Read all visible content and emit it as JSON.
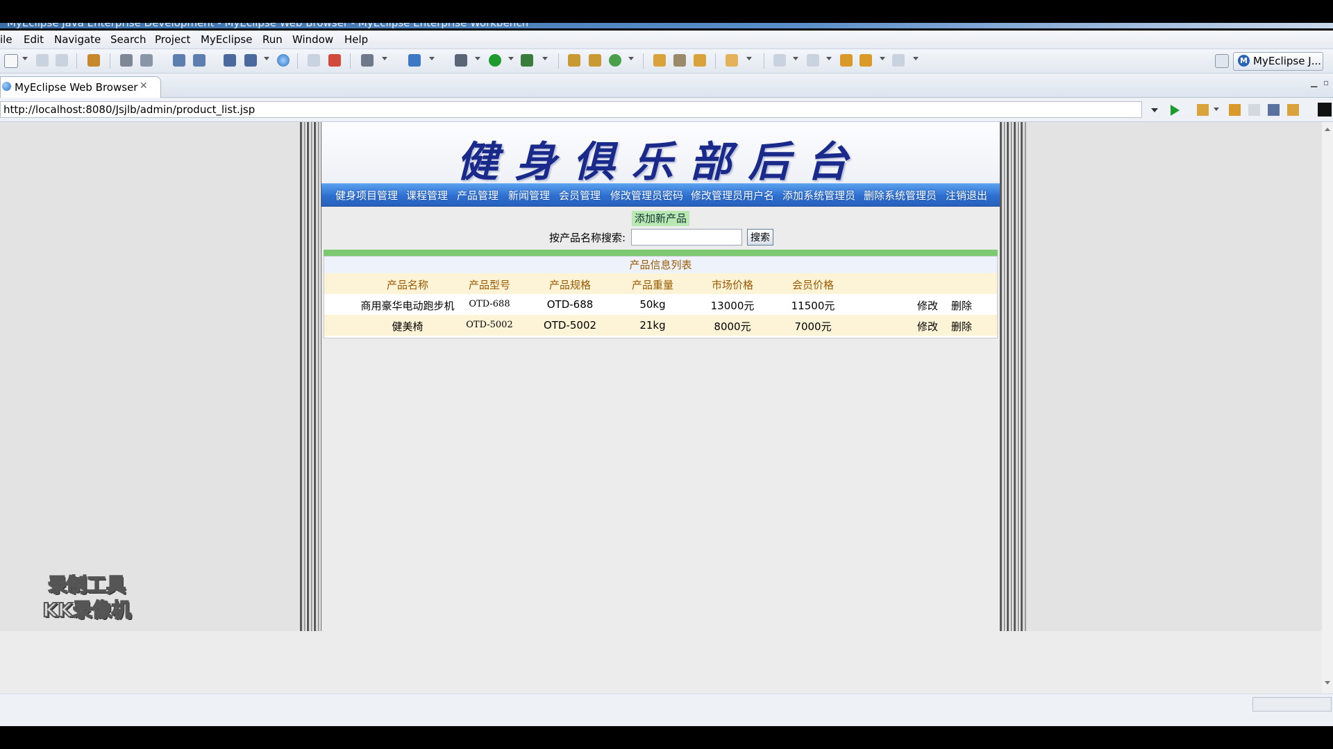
{
  "window": {
    "title": "MyEclipse Java Enterprise Development - MyEclipse Web Browser - MyEclipse Enterprise Workbench"
  },
  "menu": {
    "items": [
      "ile",
      "Edit",
      "Navigate",
      "Search",
      "Project",
      "MyEclipse",
      "Run",
      "Window",
      "Help"
    ]
  },
  "toolbar": {
    "perspective_label": "MyEclipse J..."
  },
  "editor_tab": {
    "label": "MyEclipse Web Browser",
    "close": "✕"
  },
  "address_bar": {
    "url": "http://localhost:8080/Jsjlb/admin/product_list.jsp"
  },
  "page": {
    "banner_title": "健身俱乐部后台",
    "nav": [
      "健身项目管理",
      "课程管理",
      "产品管理",
      "新闻管理",
      "会员管理",
      "修改管理员密码",
      "修改管理员用户名",
      "添加系统管理员",
      "删除系统管理员",
      "注销退出"
    ],
    "add_link": "添加新产品",
    "search": {
      "label": "按产品名称搜索:",
      "value": "",
      "button": "搜索"
    },
    "table": {
      "caption": "产品信息列表",
      "headers": [
        "产品名称",
        "产品型号",
        "产品规格",
        "产品重量",
        "市场价格",
        "会员价格"
      ],
      "rows": [
        {
          "name": "商用豪华电动跑步机",
          "model": "OTD-688",
          "spec": "OTD-688",
          "weight": "50kg",
          "market_price": "13000元",
          "member_price": "11500元",
          "edit": "修改",
          "delete": "删除"
        },
        {
          "name": "健美椅",
          "model": "OTD-5002",
          "spec": "OTD-5002",
          "weight": "21kg",
          "market_price": "8000元",
          "member_price": "7000元",
          "edit": "修改",
          "delete": "删除"
        }
      ]
    }
  },
  "watermark": {
    "line1": "录制工具",
    "line2": "KK录像机"
  },
  "colors": {
    "nav_bar": "#2d6fd0",
    "banner_text": "#1a2a8a",
    "green_bar": "#7dc96f",
    "header_text": "#9a5a00"
  }
}
